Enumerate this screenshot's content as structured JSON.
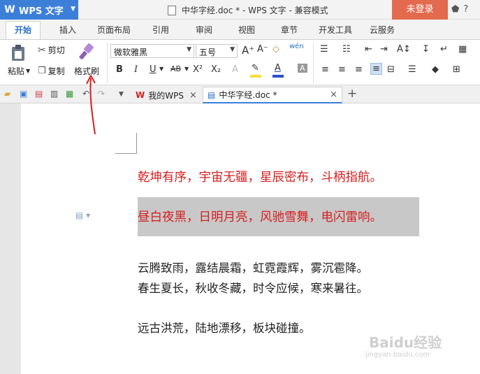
{
  "titlebar": {
    "app_name": "WPS 文字",
    "doc_title": "中华字经.doc * - WPS 文字 - 兼容模式",
    "login_label": "未登录"
  },
  "menu": {
    "tabs": [
      "开始",
      "插入",
      "页面布局",
      "引用",
      "审阅",
      "视图",
      "章节",
      "开发工具",
      "云服务"
    ]
  },
  "ribbon": {
    "paste_label": "粘贴",
    "cut_label": "剪切",
    "copy_label": "复制",
    "format_painter_label": "格式刷",
    "font_name": "微软雅黑",
    "font_size": "五号",
    "bold": "B",
    "italic": "I",
    "underline": "U",
    "strikethrough": "AB",
    "superscript": "X²",
    "subscript": "X₂",
    "font_grow": "A⁺",
    "font_shrink": "A⁻",
    "wen": "wén",
    "font_color_icon": "A",
    "char_shade_icon": "A"
  },
  "tabs": {
    "my_wps": "我的WPS",
    "doc_tab": "中华字经.doc *"
  },
  "document": {
    "line1": "乾坤有序，宇宙无疆，星辰密布，斗柄指航。",
    "line2": "昼白夜黑，日明月亮，风驰雪舞，电闪雷响。",
    "line3": "云腾致雨，露结晨霜，虹霓霞辉，雾沉雹降。",
    "line4": "春生夏长，秋收冬藏，时令应候，寒来暑往。",
    "line5": "远古洪荒，陆地漂移，板块碰撞。"
  },
  "watermark": {
    "brand": "Baidu经验",
    "url": "jingyan.baidu.com"
  },
  "colors": {
    "accent_blue": "#3c7fd9",
    "login_red": "#e46a4e",
    "text_red": "#d42020",
    "highlight_gray": "#c8c8c8"
  }
}
